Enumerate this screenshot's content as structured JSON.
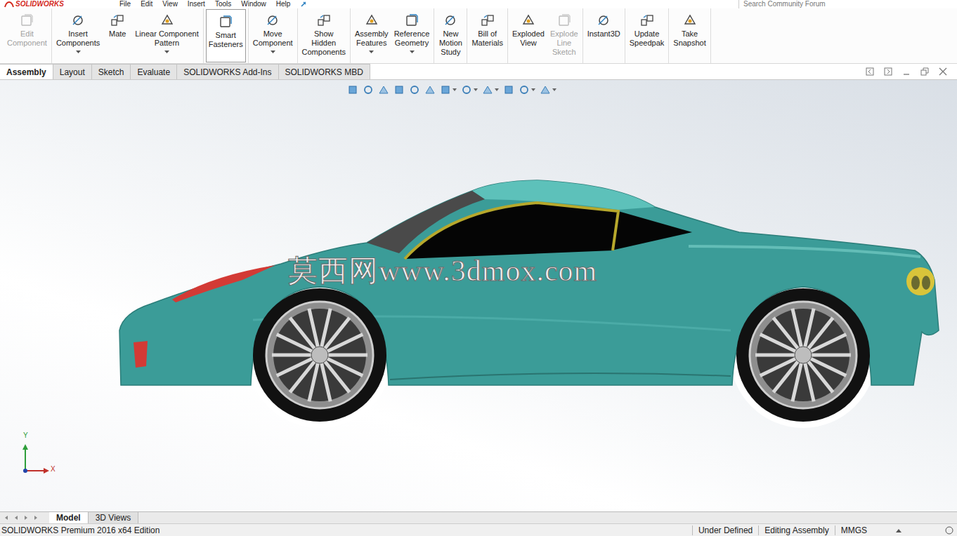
{
  "menubar": {
    "logo": "SOLIDWORKS",
    "items": [
      "File",
      "Edit",
      "View",
      "Insert",
      "Tools",
      "Window",
      "Help"
    ],
    "search": {
      "placeholder": "Search Community Forum"
    }
  },
  "ribbon": [
    {
      "buttons": [
        {
          "lines": [
            "Edit",
            "Component"
          ],
          "disabled": true,
          "selected": false,
          "dropdown": false
        }
      ]
    },
    {
      "buttons": [
        {
          "lines": [
            "Insert",
            "Components"
          ],
          "disabled": false,
          "selected": false,
          "dropdown": true
        },
        {
          "lines": [
            "Mate"
          ],
          "disabled": false,
          "selected": false,
          "dropdown": false
        },
        {
          "lines": [
            "Linear Component",
            "Pattern"
          ],
          "disabled": false,
          "selected": false,
          "dropdown": true
        }
      ]
    },
    {
      "buttons": [
        {
          "lines": [
            "Smart",
            "Fasteners"
          ],
          "disabled": false,
          "selected": true,
          "dropdown": false
        }
      ]
    },
    {
      "buttons": [
        {
          "lines": [
            "Move",
            "Component"
          ],
          "disabled": false,
          "selected": false,
          "dropdown": true
        }
      ]
    },
    {
      "buttons": [
        {
          "lines": [
            "Show",
            "Hidden",
            "Components"
          ],
          "disabled": false,
          "selected": false,
          "dropdown": false
        }
      ]
    },
    {
      "buttons": [
        {
          "lines": [
            "Assembly",
            "Features"
          ],
          "disabled": false,
          "selected": false,
          "dropdown": true
        },
        {
          "lines": [
            "Reference",
            "Geometry"
          ],
          "disabled": false,
          "selected": false,
          "dropdown": true
        }
      ]
    },
    {
      "buttons": [
        {
          "lines": [
            "New",
            "Motion",
            "Study"
          ],
          "disabled": false,
          "selected": false,
          "dropdown": false
        }
      ]
    },
    {
      "buttons": [
        {
          "lines": [
            "Bill of",
            "Materials"
          ],
          "disabled": false,
          "selected": false,
          "dropdown": false
        }
      ]
    },
    {
      "buttons": [
        {
          "lines": [
            "Exploded",
            "View"
          ],
          "disabled": false,
          "selected": false,
          "dropdown": false
        },
        {
          "lines": [
            "Explode",
            "Line",
            "Sketch"
          ],
          "disabled": true,
          "selected": false,
          "dropdown": false
        }
      ]
    },
    {
      "buttons": [
        {
          "lines": [
            "Instant3D"
          ],
          "disabled": false,
          "selected": false,
          "dropdown": false
        }
      ]
    },
    {
      "buttons": [
        {
          "lines": [
            "Update",
            "Speedpak"
          ],
          "disabled": false,
          "selected": false,
          "dropdown": false
        }
      ]
    },
    {
      "buttons": [
        {
          "lines": [
            "Take",
            "Snapshot"
          ],
          "disabled": false,
          "selected": false,
          "dropdown": false
        }
      ]
    }
  ],
  "tabs": [
    {
      "label": "Assembly",
      "selected": true
    },
    {
      "label": "Layout",
      "selected": false
    },
    {
      "label": "Sketch",
      "selected": false
    },
    {
      "label": "Evaluate",
      "selected": false
    },
    {
      "label": "SOLIDWORKS Add-Ins",
      "selected": false
    },
    {
      "label": "SOLIDWORKS MBD",
      "selected": false
    }
  ],
  "view_toolbar": [
    {
      "dropdown": false
    },
    {
      "dropdown": false
    },
    {
      "dropdown": false
    },
    {
      "dropdown": false
    },
    {
      "dropdown": false
    },
    {
      "dropdown": false
    },
    {
      "dropdown": true
    },
    {
      "dropdown": true
    },
    {
      "dropdown": true
    },
    {
      "dropdown": false
    },
    {
      "dropdown": true
    },
    {
      "dropdown": true
    }
  ],
  "watermark": "莫西网www.3dmox.com",
  "triad": {
    "y": "Y",
    "x": "X"
  },
  "bottom_tabs": [
    {
      "label": "Model",
      "selected": true
    },
    {
      "label": "3D Views",
      "selected": false
    }
  ],
  "status_bar": {
    "edition": "SOLIDWORKS Premium 2016 x64 Edition",
    "items": [
      "Under Defined",
      "Editing Assembly",
      "MMGS"
    ]
  }
}
